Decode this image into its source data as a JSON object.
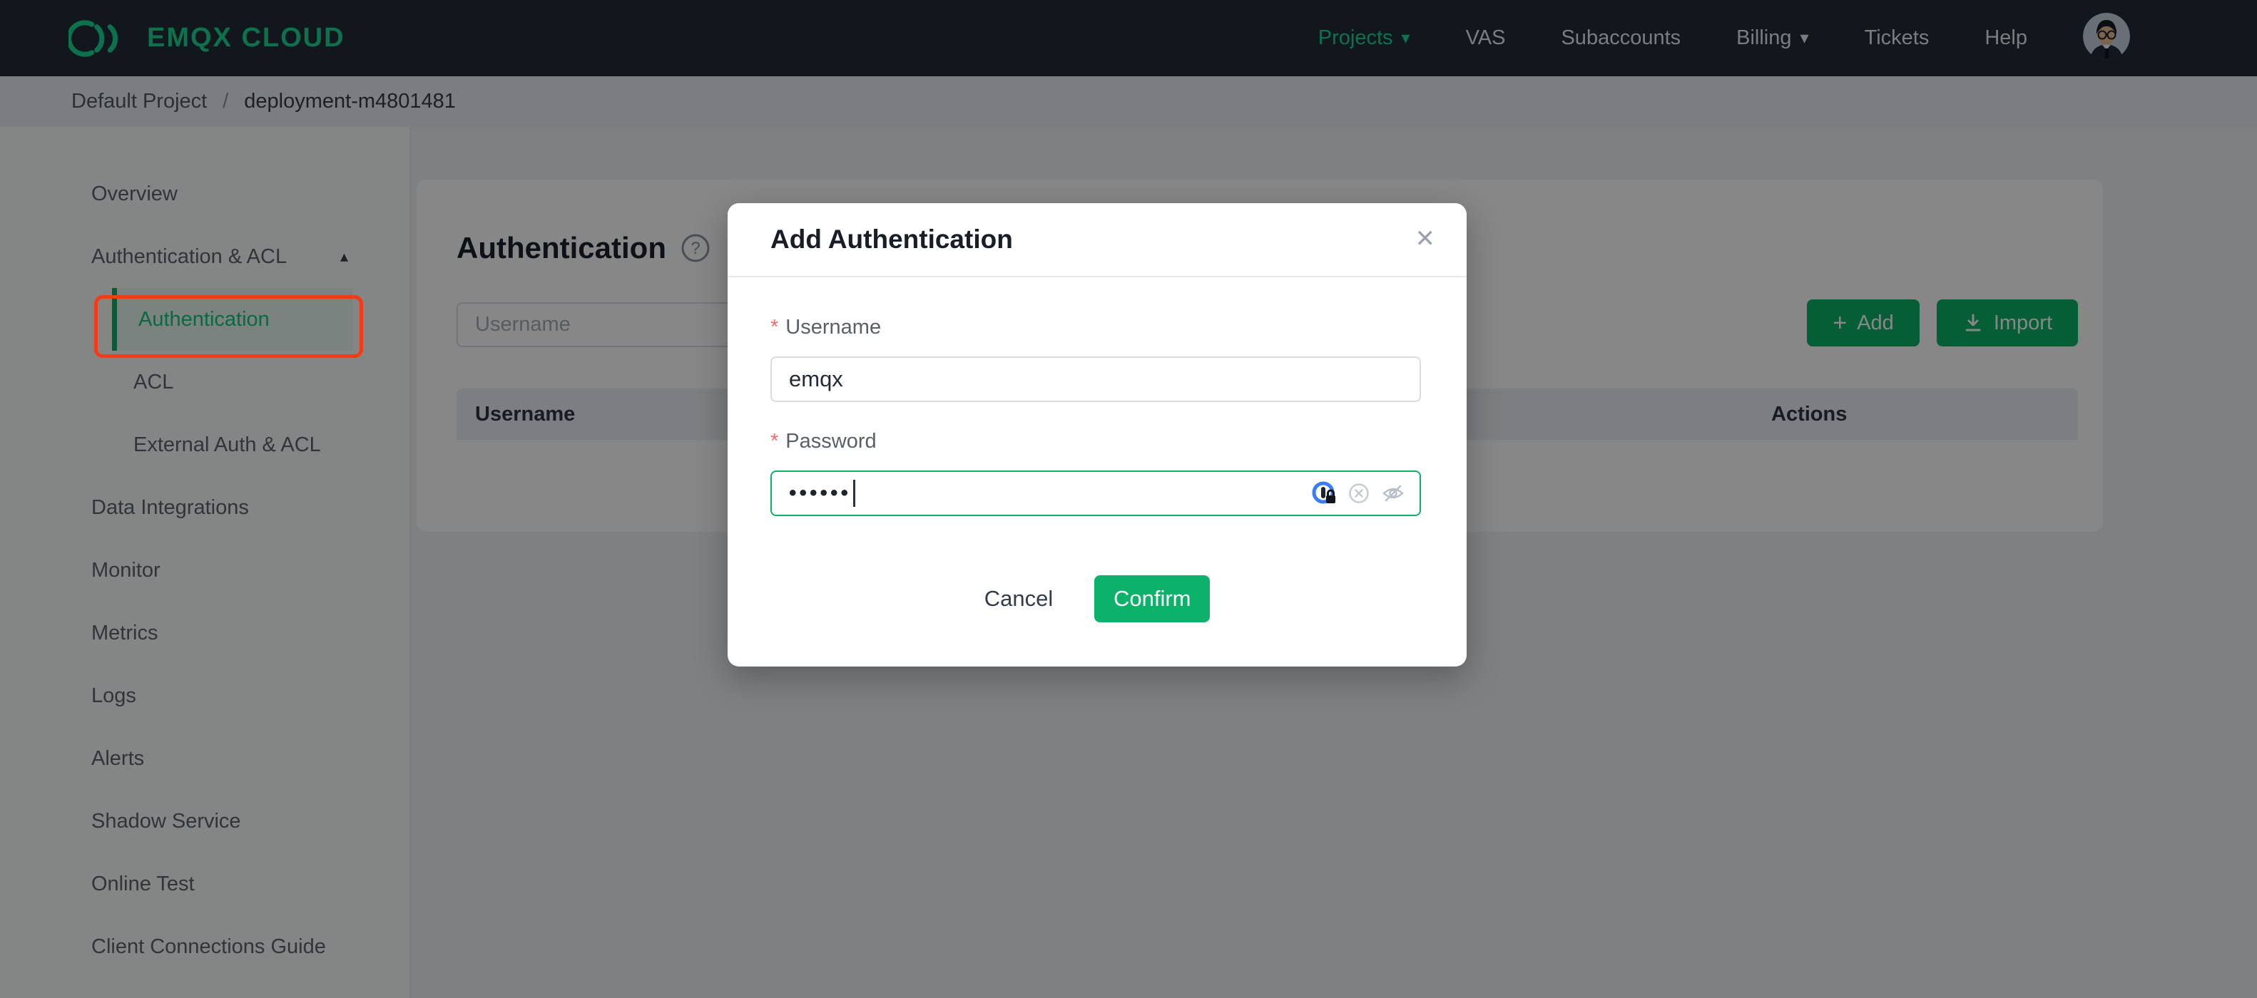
{
  "navbar": {
    "brand": "EMQX CLOUD",
    "items": [
      {
        "label": "Projects",
        "active": true,
        "caret": true
      },
      {
        "label": "VAS"
      },
      {
        "label": "Subaccounts"
      },
      {
        "label": "Billing",
        "caret": true
      },
      {
        "label": "Tickets"
      },
      {
        "label": "Help"
      }
    ]
  },
  "breadcrumb": {
    "items": [
      "Default Project",
      "deployment-m4801481"
    ],
    "separator": "/"
  },
  "sidebar": {
    "items": [
      {
        "label": "Overview"
      },
      {
        "label": "Authentication & ACL",
        "expanded": true
      },
      {
        "label": "Authentication",
        "active": true
      },
      {
        "label": "ACL"
      },
      {
        "label": "External Auth & ACL"
      },
      {
        "label": "Data Integrations"
      },
      {
        "label": "Monitor"
      },
      {
        "label": "Metrics"
      },
      {
        "label": "Logs"
      },
      {
        "label": "Alerts"
      },
      {
        "label": "Shadow Service"
      },
      {
        "label": "Online Test"
      },
      {
        "label": "Client Connections Guide"
      }
    ]
  },
  "main": {
    "title": "Authentication",
    "search": {
      "placeholder": "Username",
      "value": ""
    },
    "buttons": {
      "add": "Add",
      "import": "Import"
    },
    "table": {
      "columns": [
        "Username",
        "Actions"
      ]
    }
  },
  "modal": {
    "title": "Add Authentication",
    "fields": [
      {
        "label": "Username",
        "required": true,
        "value": "emqx"
      },
      {
        "label": "Password",
        "required": true,
        "value": "••••••",
        "focused": true
      }
    ],
    "footer": {
      "cancel": "Cancel",
      "confirm": "Confirm"
    }
  },
  "icons": {
    "caret_down": "▾",
    "caret_up": "▴",
    "plus": "+",
    "close": "✕"
  },
  "colors": {
    "accent_green": "#0cb269",
    "brand_green": "#19d690",
    "navbar_bg": "#222a38",
    "annotation_red": "#f53b13",
    "asterisk_red": "#f56c6c"
  }
}
